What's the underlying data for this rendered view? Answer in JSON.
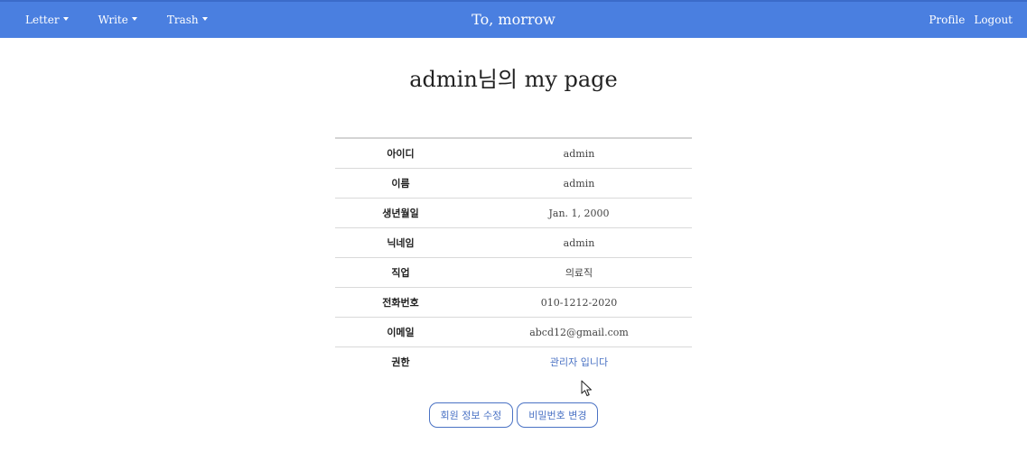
{
  "navbar": {
    "menus": [
      {
        "label": "Letter"
      },
      {
        "label": "Write"
      },
      {
        "label": "Trash"
      }
    ],
    "brand": "To, morrow",
    "right_links": [
      {
        "label": "Profile"
      },
      {
        "label": "Logout"
      }
    ],
    "background_color": "#4a7fe0"
  },
  "page": {
    "title": "admin님의 my page"
  },
  "profile": {
    "rows": [
      {
        "label": "아이디",
        "value": "admin"
      },
      {
        "label": "이름",
        "value": "admin"
      },
      {
        "label": "생년월일",
        "value": "Jan. 1, 2000"
      },
      {
        "label": "닉네임",
        "value": "admin"
      },
      {
        "label": "직업",
        "value": "의료직"
      },
      {
        "label": "전화번호",
        "value": "010-1212-2020"
      },
      {
        "label": "이메일",
        "value": "abcd12@gmail.com"
      },
      {
        "label": "권한",
        "value": "관리자 입니다"
      }
    ]
  },
  "actions": {
    "edit_info": "회원 정보 수정",
    "change_password": "비밀번호 변경"
  },
  "icons": {
    "cursor": "mouse-pointer-icon"
  }
}
